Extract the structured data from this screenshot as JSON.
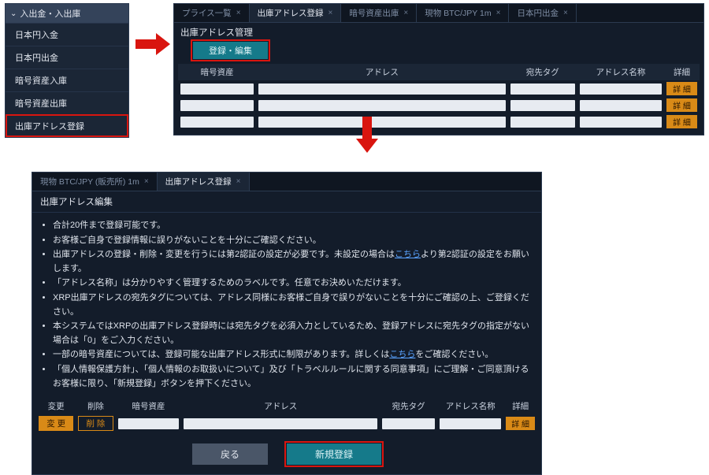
{
  "sidebar": {
    "header": "入出金・入出庫",
    "items": [
      {
        "label": "日本円入金"
      },
      {
        "label": "日本円出金"
      },
      {
        "label": "暗号資産入庫"
      },
      {
        "label": "暗号資産出庫"
      },
      {
        "label": "出庫アドレス登録",
        "highlight": true
      }
    ]
  },
  "panel1": {
    "tabs": [
      {
        "label": "プライス一覧",
        "active": false
      },
      {
        "label": "出庫アドレス登録",
        "active": true
      },
      {
        "label": "暗号資産出庫",
        "active": false
      },
      {
        "label": "現物 BTC/JPY 1m",
        "active": false
      },
      {
        "label": "日本円出金",
        "active": false
      }
    ],
    "title": "出庫アドレス管理",
    "register_edit_button": "登録・編集",
    "columns": {
      "asset": "暗号資産",
      "address": "アドレス",
      "dest_tag": "宛先タグ",
      "addr_name": "アドレス名称",
      "detail": "詳細"
    },
    "detail_button": "詳 細",
    "row_count": 3
  },
  "panel2": {
    "tabs": [
      {
        "label": "現物 BTC/JPY (販売所) 1m",
        "active": false
      },
      {
        "label": "出庫アドレス登録",
        "active": true
      }
    ],
    "title": "出庫アドレス編集",
    "notes": [
      {
        "text": "合計20件まで登録可能です。"
      },
      {
        "text": "お客様ご自身で登録情報に誤りがないことを十分にご確認ください。"
      },
      {
        "text_a": "出庫アドレスの登録・削除・変更を行うには第2認証の設定が必要です。未設定の場合は",
        "link": "こちら",
        "text_b": "より第2認証の設定をお願いします。"
      },
      {
        "text": "「アドレス名称」は分かりやすく管理するためのラベルです。任意でお決めいただけます。"
      },
      {
        "text": "XRP出庫アドレスの宛先タグについては、アドレス同様にお客様ご自身で誤りがないことを十分にご確認の上、ご登録ください。"
      },
      {
        "text": "本システムではXRPの出庫アドレス登録時には宛先タグを必須入力としているため、登録アドレスに宛先タグの指定がない場合は「0」をご入力ください。"
      },
      {
        "text_a": "一部の暗号資産については、登録可能な出庫アドレス形式に制限があります。詳しくは",
        "link": "こちら",
        "text_b": "をご確認ください。"
      },
      {
        "text": "「個人情報保護方針」、「個人情報のお取扱いについて」及び「トラベルルールに関する同意事項」にご理解・ご同意頂けるお客様に限り、「新規登録」ボタンを押下ください。"
      }
    ],
    "columns": {
      "change": "変更",
      "delete": "削除",
      "asset": "暗号資産",
      "address": "アドレス",
      "dest_tag": "宛先タグ",
      "addr_name": "アドレス名称",
      "detail": "詳細"
    },
    "change_button": "変 更",
    "delete_button": "削 除",
    "detail_button": "詳 細",
    "back_button": "戻る",
    "new_button": "新規登録"
  }
}
